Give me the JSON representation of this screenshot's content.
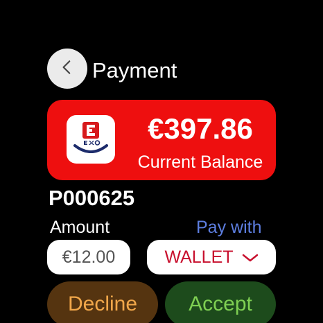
{
  "header": {
    "title": "Payment",
    "back_icon": "chevron-left-icon"
  },
  "balance": {
    "amount": "€397.86",
    "label": "Current Balance",
    "logo_icon": "exo-wallet-logo",
    "logo_text": "EXO",
    "card_color": "#ee0f0f"
  },
  "payment": {
    "reference": "P000625",
    "amount_label": "Amount",
    "amount_value": "€12.00",
    "pay_with_label": "Pay with",
    "pay_with_value": "WALLET",
    "dropdown_icon": "chevron-down-icon"
  },
  "actions": {
    "decline_label": "Decline",
    "accept_label": "Accept"
  },
  "colors": {
    "decline_bg": "#553410",
    "decline_text": "#f1a74a",
    "accept_bg": "#1d4b1c",
    "accept_text": "#7ecf52",
    "pay_with_label": "#5d7ee0",
    "wallet_text": "#c8102e"
  }
}
